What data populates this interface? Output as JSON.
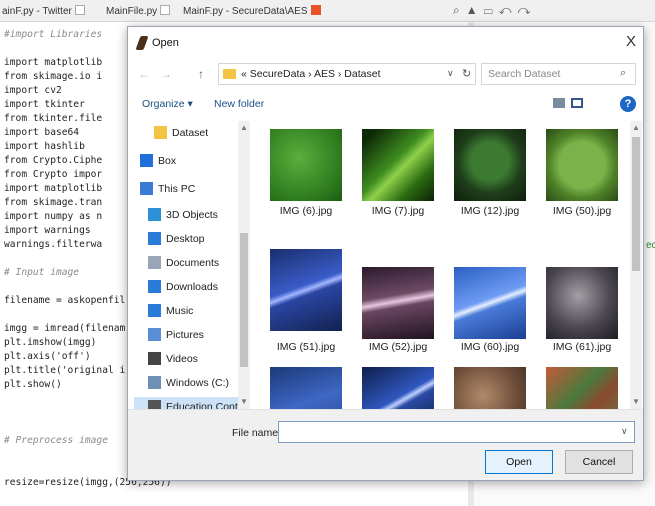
{
  "editor_tabs": [
    {
      "label": "ainF.py - Twitter",
      "active": false
    },
    {
      "label": "MainFile.py",
      "active": false
    },
    {
      "label": "MainF.py - SecureData\\AES",
      "active": true
    }
  ],
  "code_lines": [
    {
      "text": "#import Libraries",
      "cls": "cm"
    },
    {
      "text": "",
      "cls": ""
    },
    {
      "text": "import matplotlib",
      "cls": ""
    },
    {
      "text": "from skimage.io i",
      "cls": ""
    },
    {
      "text": "import cv2",
      "cls": ""
    },
    {
      "text": "import tkinter",
      "cls": ""
    },
    {
      "text": "from tkinter.file",
      "cls": ""
    },
    {
      "text": "import base64",
      "cls": ""
    },
    {
      "text": "import hashlib",
      "cls": ""
    },
    {
      "text": "from Crypto.Ciphe",
      "cls": ""
    },
    {
      "text": "from Crypto impor",
      "cls": ""
    },
    {
      "text": "import matplotlib",
      "cls": ""
    },
    {
      "text": "from skimage.tran",
      "cls": ""
    },
    {
      "text": "import numpy as n",
      "cls": ""
    },
    {
      "text": "import warnings",
      "cls": ""
    },
    {
      "text": "warnings.filterwa",
      "cls": ""
    },
    {
      "text": "",
      "cls": ""
    },
    {
      "text": "# Input image",
      "cls": "cm"
    },
    {
      "text": "",
      "cls": ""
    },
    {
      "text": "filename = askopenfil",
      "cls": ""
    },
    {
      "text": "",
      "cls": ""
    },
    {
      "text": "imgg = imread(filenam",
      "cls": ""
    },
    {
      "text": "plt.imshow(imgg)",
      "cls": ""
    },
    {
      "text": "plt.axis('off')",
      "cls": ""
    },
    {
      "text": "plt.title('original i",
      "cls": ""
    },
    {
      "text": "plt.show()",
      "cls": ""
    },
    {
      "text": "",
      "cls": ""
    },
    {
      "text": "",
      "cls": ""
    },
    {
      "text": "",
      "cls": ""
    },
    {
      "text": "# Preprocess image",
      "cls": "cm"
    },
    {
      "text": "",
      "cls": ""
    },
    {
      "text": "",
      "cls": ""
    },
    {
      "text": "resize=resize(imgg,(256,256))",
      "cls": ""
    }
  ],
  "right_edge_text": "ec",
  "dialog": {
    "title": "Open",
    "close_label": "X",
    "nav": {
      "back": "←",
      "forward": "→",
      "up": "↑"
    },
    "address": {
      "path": "« SecureData › AES › Dataset",
      "dropdown": "∨",
      "refresh": "↻"
    },
    "search": {
      "placeholder": "Search Dataset",
      "icon": "⌕"
    },
    "toolbar": {
      "organize": "Organize ▾",
      "new_folder": "New folder",
      "help": "?"
    },
    "nav_items": [
      {
        "label": "Dataset",
        "icon": "folder-icon",
        "color": "#f3c443",
        "indent": 20,
        "selected": false
      },
      {
        "label": "Box",
        "icon": "box-icon",
        "color": "#1e6fd9",
        "indent": 6,
        "selected": false
      },
      {
        "label": "This PC",
        "icon": "computer-icon",
        "color": "#3a7bd5",
        "indent": 6,
        "selected": false
      },
      {
        "label": "3D Objects",
        "icon": "cube-icon",
        "color": "#2d8fd6",
        "indent": 14,
        "selected": false
      },
      {
        "label": "Desktop",
        "icon": "desktop-icon",
        "color": "#2a7ad8",
        "indent": 14,
        "selected": false
      },
      {
        "label": "Documents",
        "icon": "document-icon",
        "color": "#9aa6b8",
        "indent": 14,
        "selected": false
      },
      {
        "label": "Downloads",
        "icon": "download-icon",
        "color": "#2a7ad8",
        "indent": 14,
        "selected": false
      },
      {
        "label": "Music",
        "icon": "music-icon",
        "color": "#2a7ad8",
        "indent": 14,
        "selected": false
      },
      {
        "label": "Pictures",
        "icon": "picture-icon",
        "color": "#5a8fd8",
        "indent": 14,
        "selected": false
      },
      {
        "label": "Videos",
        "icon": "video-icon",
        "color": "#444444",
        "indent": 14,
        "selected": false
      },
      {
        "label": "Windows (C:)",
        "icon": "drive-icon",
        "color": "#6f8fb5",
        "indent": 14,
        "selected": false
      },
      {
        "label": "Education Contr",
        "icon": "drive-icon",
        "color": "#555555",
        "indent": 14,
        "selected": true
      }
    ],
    "files": [
      {
        "name": "IMG (6).jpg",
        "thumb": "g-leaf1"
      },
      {
        "name": "IMG (7).jpg",
        "thumb": "g-leaf2"
      },
      {
        "name": "IMG (12).jpg",
        "thumb": "g-lily"
      },
      {
        "name": "IMG (50).jpg",
        "thumb": "g-round"
      },
      {
        "name": "IMG (51).jpg",
        "thumb": "g-bolt1"
      },
      {
        "name": "IMG (52).jpg",
        "thumb": "g-bolt2"
      },
      {
        "name": "IMG (60).jpg",
        "thumb": "g-bolt3"
      },
      {
        "name": "IMG (61).jpg",
        "thumb": "g-bolt4"
      },
      {
        "name": "",
        "thumb": "g-bolt5"
      },
      {
        "name": "",
        "thumb": "g-bolt6"
      },
      {
        "name": "",
        "thumb": "g-leaves"
      },
      {
        "name": "",
        "thumb": "g-plant"
      }
    ],
    "file_name_label": "File name:",
    "file_name_value": "",
    "open_label": "Open",
    "cancel_label": "Cancel"
  }
}
